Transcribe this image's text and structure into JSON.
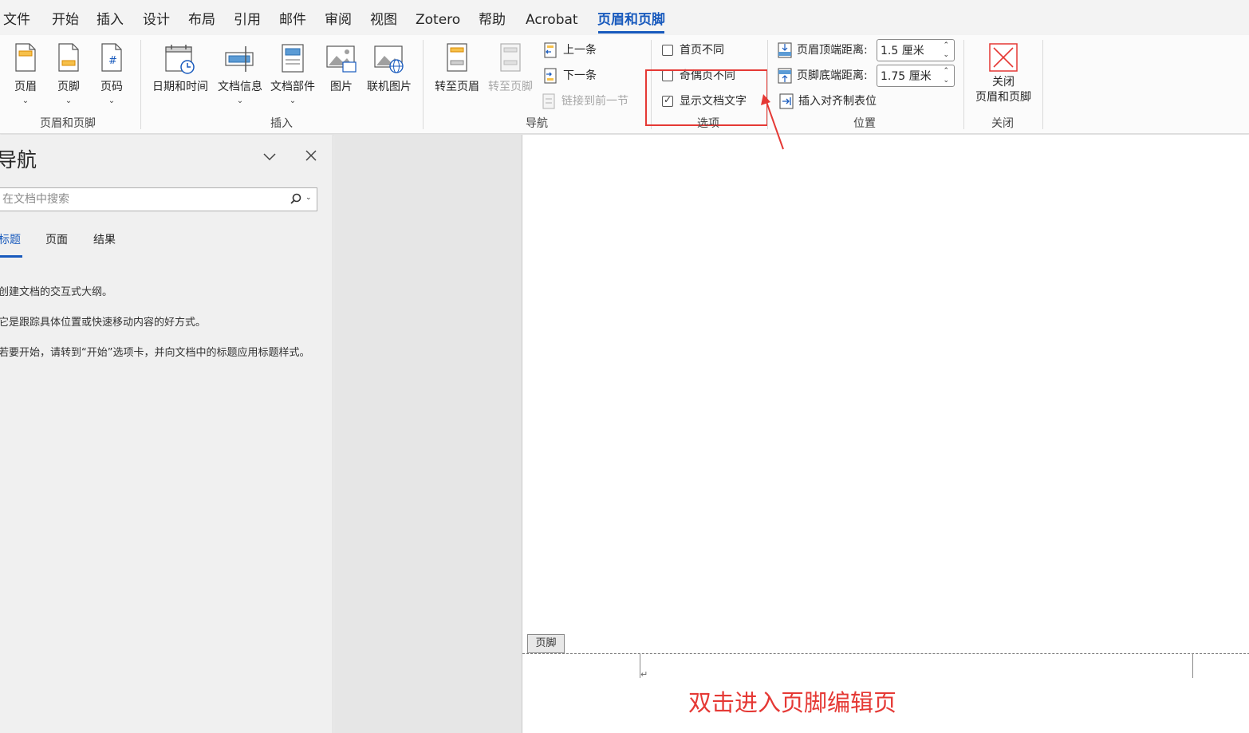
{
  "menu": {
    "items": [
      "文件",
      "开始",
      "插入",
      "设计",
      "布局",
      "引用",
      "邮件",
      "审阅",
      "视图",
      "Zotero",
      "帮助",
      "Acrobat",
      "页眉和页脚"
    ],
    "active": "页眉和页脚"
  },
  "ribbon": {
    "header_footer_group": {
      "label": "页眉和页脚",
      "header": "页眉",
      "footer": "页脚",
      "page_number": "页码"
    },
    "insert_group": {
      "label": "插入",
      "date_time": "日期和时间",
      "doc_info": "文档信息",
      "quick_parts": "文档部件",
      "picture": "图片",
      "online_picture": "联机图片"
    },
    "navigation_group": {
      "label": "导航",
      "goto_header": "转至页眉",
      "goto_footer": "转至页脚",
      "previous": "上一条",
      "next": "下一条",
      "link_previous": "链接到前一节"
    },
    "options_group": {
      "label": "选项",
      "different_first_page": "首页不同",
      "different_first_page_checked": false,
      "different_odd_even": "奇偶页不同",
      "different_odd_even_checked": false,
      "show_doc_text": "显示文档文字",
      "show_doc_text_checked": true
    },
    "position_group": {
      "label": "位置",
      "header_from_top": "页眉顶端距离:",
      "header_from_top_value": "1.5 厘米",
      "footer_from_bottom": "页脚底端距离:",
      "footer_from_bottom_value": "1.75 厘米",
      "insert_align_tab": "插入对齐制表位"
    },
    "close_group": {
      "label": "关闭",
      "close_line1": "关闭",
      "close_line2": "页眉和页脚"
    }
  },
  "nav_pane": {
    "title": "导航",
    "search_placeholder": "在文档中搜索",
    "tabs": [
      "标题",
      "页面",
      "结果"
    ],
    "active_tab": "标题",
    "help_lines": [
      "创建文档的交互式大纲。",
      "它是跟踪具体位置或快速移动内容的好方式。",
      "若要开始，请转到“开始”选项卡，并向文档中的标题应用标题样式。"
    ]
  },
  "document": {
    "footer_tag": "页脚",
    "annotation": "双击进入页脚编辑页"
  },
  "colors": {
    "accent": "#185abd",
    "annotation_red": "#e53935"
  }
}
